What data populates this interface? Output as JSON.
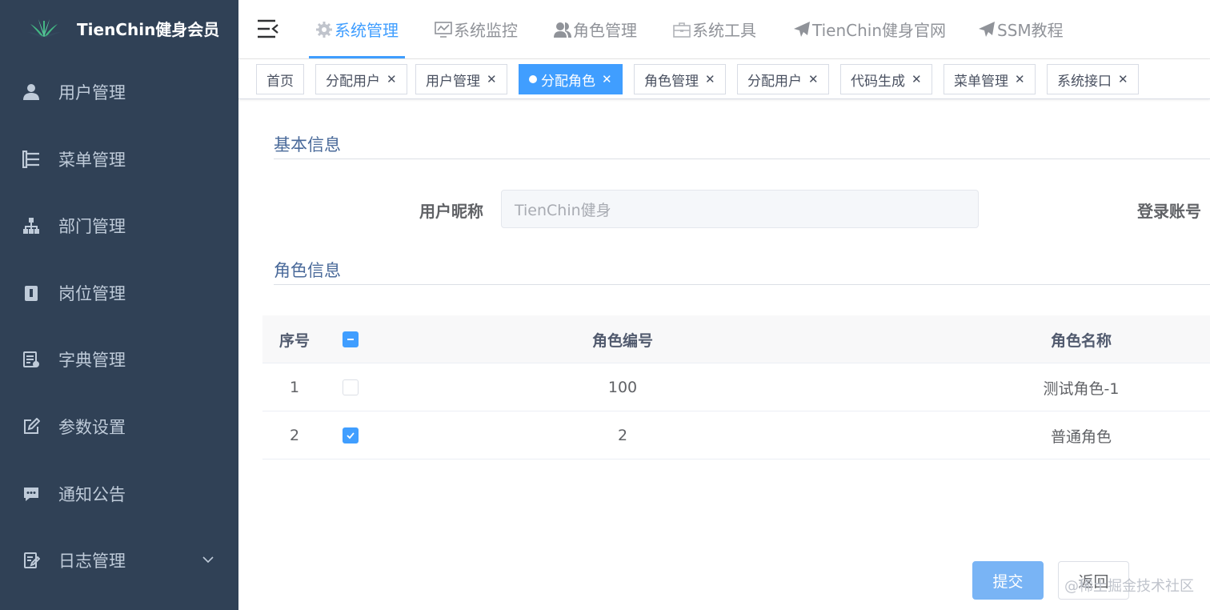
{
  "brand": {
    "title": "TienChin健身会员"
  },
  "sidebar": {
    "items": [
      {
        "label": "用户管理",
        "icon": "user-icon"
      },
      {
        "label": "菜单管理",
        "icon": "tree-table-icon"
      },
      {
        "label": "部门管理",
        "icon": "org-tree-icon"
      },
      {
        "label": "岗位管理",
        "icon": "post-icon"
      },
      {
        "label": "字典管理",
        "icon": "dict-icon"
      },
      {
        "label": "参数设置",
        "icon": "edit-icon"
      },
      {
        "label": "通知公告",
        "icon": "message-icon"
      },
      {
        "label": "日志管理",
        "icon": "log-icon",
        "expandable": true
      }
    ]
  },
  "topnav": {
    "items": [
      {
        "label": "系统管理",
        "icon": "gear-icon",
        "active": true
      },
      {
        "label": "系统监控",
        "icon": "monitor-icon"
      },
      {
        "label": "角色管理",
        "icon": "peoples-icon"
      },
      {
        "label": "系统工具",
        "icon": "toolbox-icon"
      },
      {
        "label": "TienChin健身官网",
        "icon": "paper-plane-icon"
      },
      {
        "label": "SSM教程",
        "icon": "paper-plane-icon"
      }
    ]
  },
  "tags": [
    {
      "label": "首页",
      "closable": false
    },
    {
      "label": "分配用户",
      "closable": true
    },
    {
      "label": "用户管理",
      "closable": true
    },
    {
      "label": "分配角色",
      "closable": true,
      "active": true
    },
    {
      "label": "角色管理",
      "closable": true
    },
    {
      "label": "分配用户",
      "closable": true
    },
    {
      "label": "代码生成",
      "closable": true
    },
    {
      "label": "菜单管理",
      "closable": true
    },
    {
      "label": "系统接口",
      "closable": true
    }
  ],
  "basic_info": {
    "title": "基本信息",
    "nickname_label": "用户昵称",
    "nickname_value": "TienChin健身",
    "account_label": "登录账号"
  },
  "role_info": {
    "title": "角色信息",
    "columns": {
      "index": "序号",
      "code": "角色编号",
      "name": "角色名称"
    },
    "rows": [
      {
        "index": "1",
        "code": "100",
        "name": "测试角色-1",
        "checked": false
      },
      {
        "index": "2",
        "code": "2",
        "name": "普通角色",
        "checked": true
      }
    ]
  },
  "actions": {
    "submit": "提交",
    "back": "返回"
  },
  "watermark": "@稀土掘金技术社区",
  "colors": {
    "sidebar_bg": "#304156",
    "primary": "#409eff",
    "section_title": "#4a6a9a"
  }
}
